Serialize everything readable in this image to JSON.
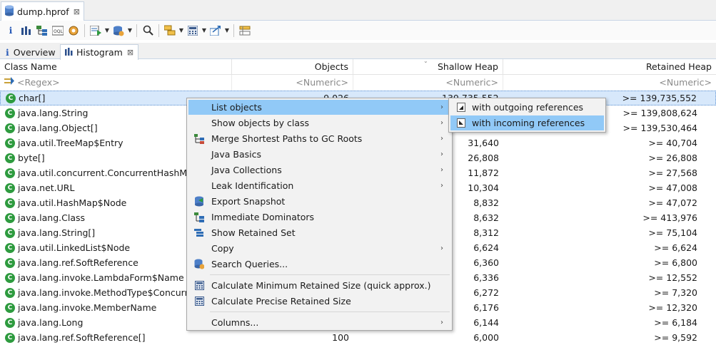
{
  "file_tab": {
    "label": "dump.hprof",
    "close": "⊠"
  },
  "view_tabs": [
    {
      "label": "Overview"
    },
    {
      "label": "Histogram",
      "close": "⊠"
    }
  ],
  "columns": [
    "Class Name",
    "Objects",
    "Shallow Heap",
    "Retained Heap"
  ],
  "filters": [
    "<Regex>",
    "<Numeric>",
    "<Numeric>",
    "<Numeric>"
  ],
  "rows": [
    {
      "name": "char[]",
      "objects": "9,026",
      "shallow": "139,735,552",
      "retained": ">= 139,735,552"
    },
    {
      "name": "java.lang.String",
      "objects": "",
      "shallow": "",
      "retained": ">= 139,808,624"
    },
    {
      "name": "java.lang.Object[]",
      "objects": "",
      "shallow": "",
      "retained": ">= 139,530,464"
    },
    {
      "name": "java.util.TreeMap$Entry",
      "objects": "",
      "shallow": "31,640",
      "retained": ">= 40,704"
    },
    {
      "name": "byte[]",
      "objects": "",
      "shallow": "26,808",
      "retained": ">= 26,808"
    },
    {
      "name": "java.util.concurrent.ConcurrentHashMap$",
      "objects": "",
      "shallow": "11,872",
      "retained": ">= 27,568"
    },
    {
      "name": "java.net.URL",
      "objects": "",
      "shallow": "10,304",
      "retained": ">= 47,008"
    },
    {
      "name": "java.util.HashMap$Node",
      "objects": "",
      "shallow": "8,832",
      "retained": ">= 47,072"
    },
    {
      "name": "java.lang.Class",
      "objects": "",
      "shallow": "8,632",
      "retained": ">= 413,976"
    },
    {
      "name": "java.lang.String[]",
      "objects": "",
      "shallow": "8,312",
      "retained": ">= 75,104"
    },
    {
      "name": "java.util.LinkedList$Node",
      "objects": "",
      "shallow": "6,624",
      "retained": ">= 6,624"
    },
    {
      "name": "java.lang.ref.SoftReference",
      "objects": "",
      "shallow": "6,360",
      "retained": ">= 6,800"
    },
    {
      "name": "java.lang.invoke.LambdaForm$Name",
      "objects": "",
      "shallow": "6,336",
      "retained": ">= 12,552"
    },
    {
      "name": "java.lang.invoke.MethodType$Concurren",
      "objects": "",
      "shallow": "6,272",
      "retained": ">= 7,320"
    },
    {
      "name": "java.lang.invoke.MemberName",
      "objects": "",
      "shallow": "6,176",
      "retained": ">= 12,320"
    },
    {
      "name": "java.lang.Long",
      "objects": "",
      "shallow": "6,144",
      "retained": ">= 6,184"
    },
    {
      "name": "java.lang.ref.SoftReference[]",
      "objects": "100",
      "shallow": "6,000",
      "retained": ">= 9,592"
    }
  ],
  "context_menu": {
    "items": [
      {
        "label": "List objects",
        "submenu": true,
        "icon": ""
      },
      {
        "label": "Show objects by class",
        "submenu": true,
        "icon": ""
      },
      {
        "label": "Merge Shortest Paths to GC Roots",
        "submenu": true,
        "icon": "merge-paths-icon"
      },
      {
        "label": "Java Basics",
        "submenu": true,
        "icon": ""
      },
      {
        "label": "Java Collections",
        "submenu": true,
        "icon": ""
      },
      {
        "label": "Leak Identification",
        "submenu": true,
        "icon": ""
      },
      {
        "label": "Export Snapshot",
        "submenu": false,
        "icon": "export-snapshot-icon"
      },
      {
        "label": "Immediate Dominators",
        "submenu": false,
        "icon": "dominators-icon"
      },
      {
        "label": "Show Retained Set",
        "submenu": false,
        "icon": "retained-set-icon"
      },
      {
        "label": "Copy",
        "submenu": true,
        "icon": ""
      },
      {
        "label": "Search Queries...",
        "submenu": false,
        "icon": "search-queries-icon"
      },
      {
        "label": "Calculate Minimum Retained Size (quick approx.)",
        "submenu": false,
        "icon": "calculator-icon"
      },
      {
        "label": "Calculate Precise Retained Size",
        "submenu": false,
        "icon": "calculator-icon"
      },
      {
        "label": "Columns...",
        "submenu": true,
        "icon": ""
      }
    ]
  },
  "submenu": {
    "items": [
      {
        "label": "with outgoing references",
        "icon": "outgoing-references-icon"
      },
      {
        "label": "with incoming references",
        "icon": "incoming-references-icon"
      }
    ]
  },
  "colors": {
    "highlight": "#91c9f7",
    "selected_row": "#d7e8fb",
    "class_icon": "#2e9b3f"
  }
}
